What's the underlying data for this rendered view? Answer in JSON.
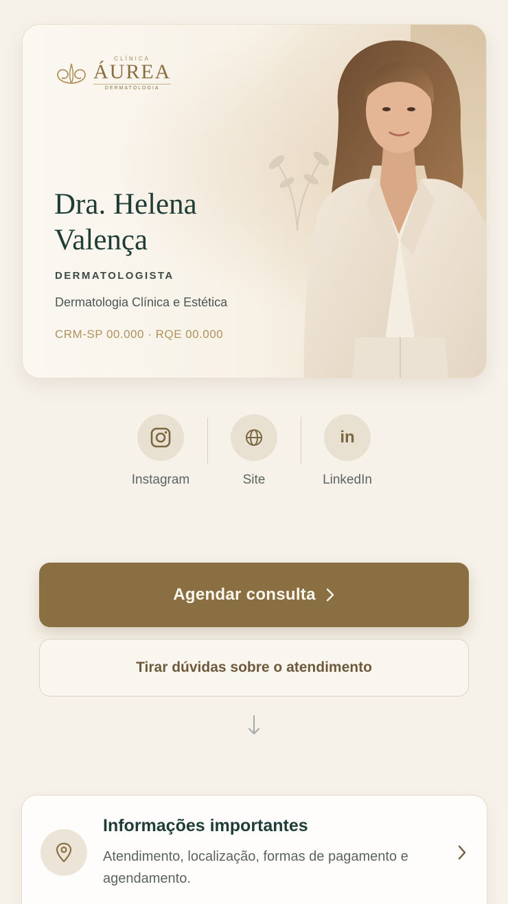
{
  "clinic": {
    "logo_top": "CLÍNICA",
    "logo_main": "ÁUREA",
    "logo_bottom": "DERMATOLOGIA"
  },
  "doctor": {
    "name": "Dra. Helena Valença",
    "specialty": "DERMATOLOGISTA",
    "subtitle": "Dermatologia Clínica e Estética",
    "credentials": "CRM-SP 00.000 · RQE 00.000"
  },
  "social": [
    {
      "label": "Instagram",
      "icon": "instagram-icon"
    },
    {
      "label": "Site",
      "icon": "globe-icon"
    },
    {
      "label": "LinkedIn",
      "icon": "linkedin-icon",
      "glyph": "in"
    }
  ],
  "actions": {
    "primary_label": "Agendar consulta",
    "secondary_label": "Tirar dúvidas sobre o atendimento"
  },
  "info_card": {
    "title": "Informações importantes",
    "description": "Atendimento, localização, formas de pagamento e agendamento."
  },
  "colors": {
    "background": "#f6f2ea",
    "accent": "#8a6f43",
    "heading": "#1f3d36",
    "gold_text": "#b0925c"
  }
}
